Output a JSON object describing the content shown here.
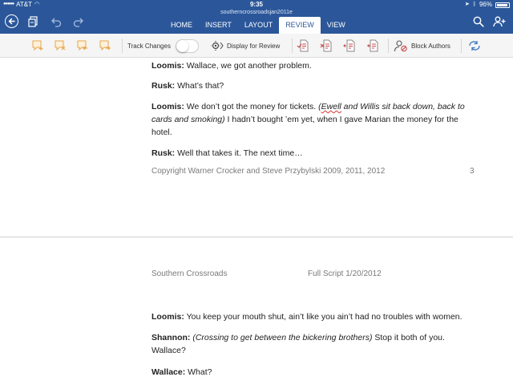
{
  "status_bar": {
    "carrier": "AT&T",
    "time": "9:35",
    "battery_text": "96%"
  },
  "document_title": "southerncrossroadsjan2011e",
  "tabs": [
    {
      "label": "HOME"
    },
    {
      "label": "INSERT"
    },
    {
      "label": "LAYOUT"
    },
    {
      "label": "REVIEW",
      "active": true
    },
    {
      "label": "VIEW"
    }
  ],
  "ribbon": {
    "track_changes_label": "Track Changes",
    "track_changes_on": false,
    "display_for_review_label": "Display for Review",
    "block_authors_label": "Block Authors"
  },
  "page1": {
    "lines": [
      {
        "speaker": "Loomis:",
        "text": " Wallace, we got another problem."
      },
      {
        "speaker": "Rusk:",
        "text": " What’s that?"
      },
      {
        "speaker": "Loomis:",
        "pre": " We don’t got the money for tickets. ",
        "direction_open": "(",
        "direction_squiggle": "Ewell",
        "direction_rest": " and Willis sit back down, back to cards and smoking)",
        "post": " I hadn’t bought ’em yet, when I gave Marian the money for the hotel."
      },
      {
        "speaker": "Rusk:",
        "text": " Well that takes it. The next time…"
      }
    ],
    "footer": "Copyright Warner Crocker and Steve Przybylski 2009, 2011, 2012",
    "page_number": "3"
  },
  "page2": {
    "header_left": "Southern Crossroads",
    "header_right": "Full Script 1/20/2012",
    "lines": [
      {
        "speaker": "Loomis:",
        "text": " You keep your mouth shut, ain’t like you ain’t had no troubles with women."
      },
      {
        "speaker": "Shannon:",
        "direction": " (Crossing to get between the bickering brothers)",
        "text": " Stop it both of you. Wallace?"
      },
      {
        "speaker": "Wallace:",
        "text": " What?"
      }
    ]
  },
  "colors": {
    "chrome_blue": "#2b579a",
    "ribbon_bg": "#f5f5f5",
    "review_icon_orange": "#e8a64a",
    "review_icon_red": "#c84a4a",
    "footer_gray": "#7a7a7a"
  }
}
